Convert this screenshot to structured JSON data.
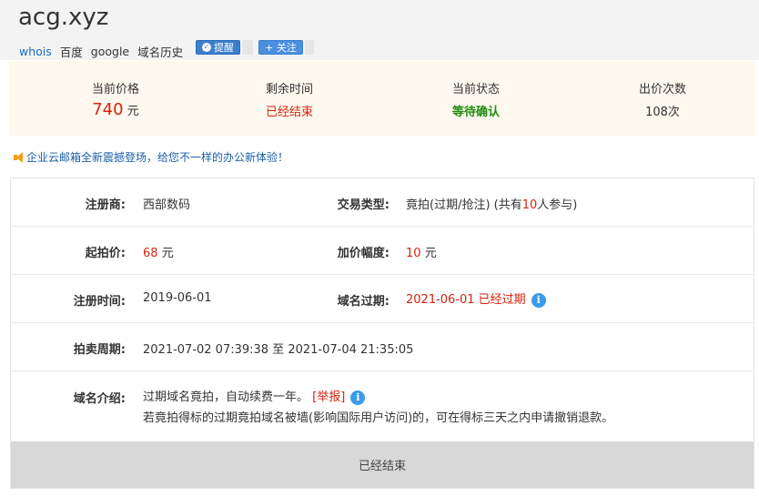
{
  "domain": "acg.xyz",
  "links": [
    "whois",
    "百度",
    "google",
    "域名历史"
  ],
  "buttons": {
    "remind": "提醒",
    "follow": "+ 关注"
  },
  "stats": {
    "price_label": "当前价格",
    "price_value": "740",
    "price_unit": "元",
    "remaining_label": "剩余时间",
    "remaining_value": "已经结束",
    "status_label": "当前状态",
    "status_value": "等待确认",
    "bids_label": "出价次数",
    "bids_value": "108次"
  },
  "notice": "企业云邮箱全新震撼登场，给您不一样的办公新体验！",
  "details": {
    "registrar_label": "注册商:",
    "registrar_value": "西部数码",
    "type_label": "交易类型:",
    "type_value_prefix": "竟拍(过期/抢注)  (共有",
    "type_value_count": "10",
    "type_value_suffix": "人参与)",
    "start_price_label": "起拍价:",
    "start_price_value": "68",
    "start_price_unit": "元",
    "increment_label": "加价幅度:",
    "increment_value": "10",
    "increment_unit": "元",
    "reg_time_label": "注册时间:",
    "reg_time_value": "2019-06-01",
    "expire_label": "域名过期:",
    "expire_value": "2021-06-01 已经过期",
    "period_label": "拍卖周期:",
    "period_value": "2021-07-02 07:39:38 至 2021-07-04 21:35:05",
    "intro_label": "域名介绍:",
    "intro_line1": "过期域名竟拍，自动续费一年。",
    "report": "[举报]",
    "intro_line2": "若竟拍得标的过期竟拍域名被墙(影响国际用户访问)的，可在得标三天之内申请撤销退款。"
  },
  "bottom_button": "已经结束",
  "colors": {
    "accent_red": "#d9230f",
    "status_green": "#1f8a10",
    "link_blue": "#1a6fbd",
    "info_blue": "#3c9be8"
  }
}
